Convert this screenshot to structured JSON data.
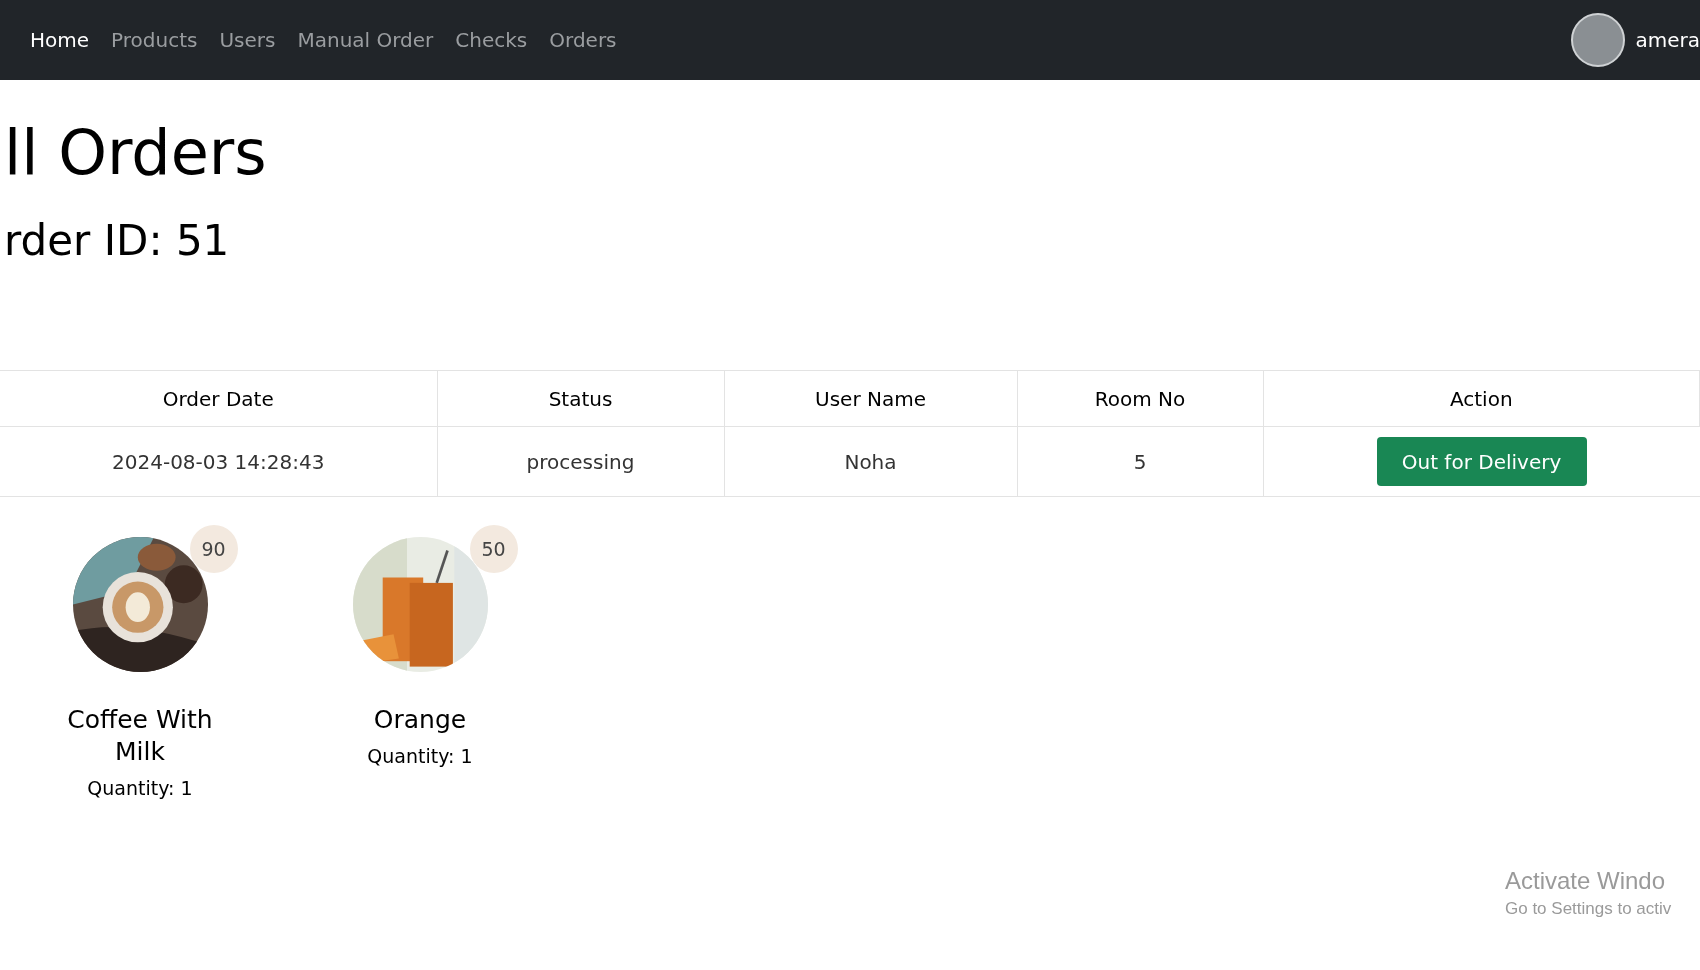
{
  "navbar": {
    "links": [
      {
        "label": "Home",
        "selected": true
      },
      {
        "label": "Products",
        "selected": false
      },
      {
        "label": "Users",
        "selected": false
      },
      {
        "label": "Manual Order",
        "selected": false
      },
      {
        "label": "Checks",
        "selected": false
      },
      {
        "label": "Orders",
        "selected": false
      }
    ],
    "user_name": "amera"
  },
  "title": "ll Orders",
  "order_heading": "rder ID: 51",
  "table": {
    "columns": [
      "Order Date",
      "Status",
      "User Name",
      "Room No",
      "Action"
    ],
    "rows": [
      {
        "order_date": "2024-08-03 14:28:43",
        "status": "processing",
        "user_name": "Noha",
        "room_no": "5",
        "action": "Out for Delivery"
      }
    ]
  },
  "items": [
    {
      "name": "Coffee With Milk",
      "price": "90",
      "quantity": "Quantity: 1",
      "kind": "coffee"
    },
    {
      "name": "Orange",
      "price": "50",
      "quantity": "Quantity: 1",
      "kind": "juice"
    }
  ],
  "os_notice": {
    "title": "Activate Windo",
    "subtitle": "Go to Settings to activ"
  }
}
